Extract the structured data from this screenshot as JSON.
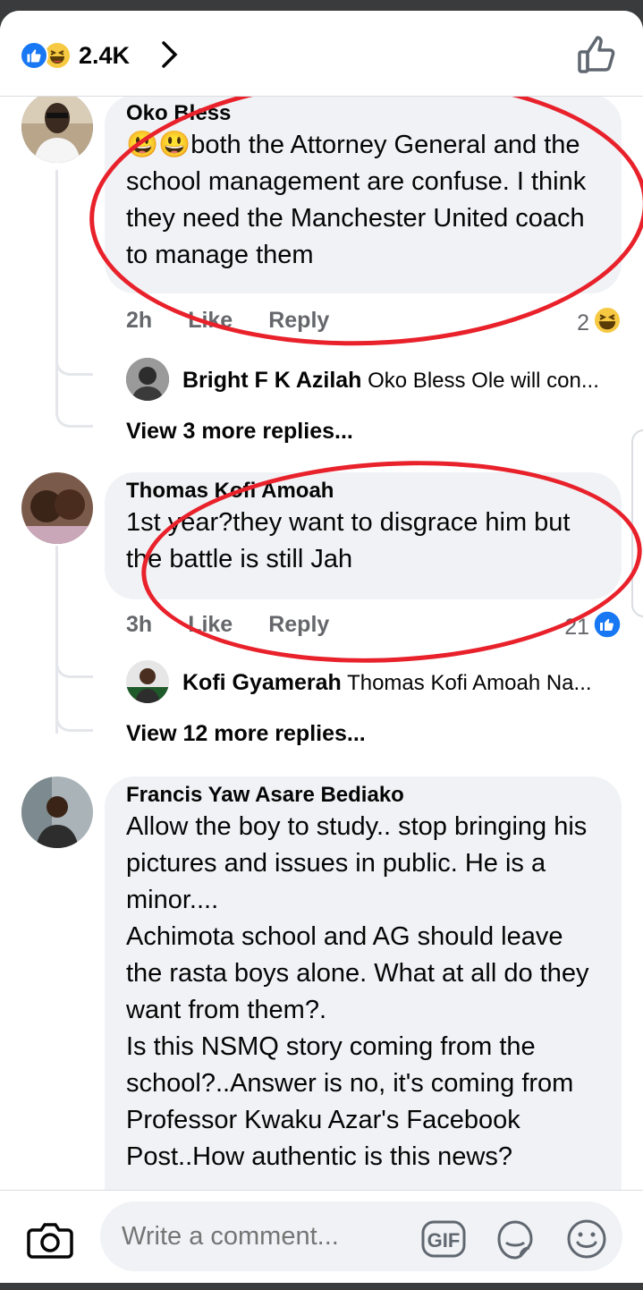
{
  "header": {
    "reaction_count": "2.4K",
    "reaction_icons": [
      "like-icon",
      "haha-icon"
    ],
    "like_button_icon": "thumbs-up-outline-icon"
  },
  "comments": [
    {
      "author": "Oko Bless",
      "text": "both the Attorney General and the school management are confuse. I think they need the Manchester United coach to manage them",
      "emoji_prefix": "😃😃",
      "time": "2h",
      "like_label": "Like",
      "reply_label": "Reply",
      "reaction_count": "2",
      "reply_preview": {
        "author": "Bright F K Azilah",
        "text": "Oko Bless Ole will con..."
      },
      "more_replies": "View 3 more replies..."
    },
    {
      "author": "Thomas Kofi Amoah",
      "text": "1st year?they want to disgrace him but the battle is still Jah",
      "time": "3h",
      "like_label": "Like",
      "reply_label": "Reply",
      "reaction_count": "21",
      "reply_preview": {
        "author": "Kofi Gyamerah",
        "text": "Thomas Kofi Amoah Na..."
      },
      "more_replies": "View 12 more replies..."
    },
    {
      "author": "Francis Yaw Asare Bediako",
      "text": "Allow the boy to study.. stop bringing his pictures and issues in public. He is a minor....\nAchimota school and AG should leave the rasta boys alone. What at all do they want from them?.\nIs this NSMQ story coming from the school?..Answer is no, it's coming from Professor Kwaku Azar's Facebook Post..How authentic is this news?"
    }
  ],
  "composer": {
    "placeholder": "Write a comment...",
    "gif_label": "GIF",
    "icons": [
      "camera-icon",
      "gif-icon",
      "sticker-icon",
      "emoji-icon"
    ]
  },
  "colors": {
    "accent": "#1877f2",
    "annotation": "#e8212b",
    "bubble": "#f0f2f5",
    "meta": "#65676b"
  }
}
